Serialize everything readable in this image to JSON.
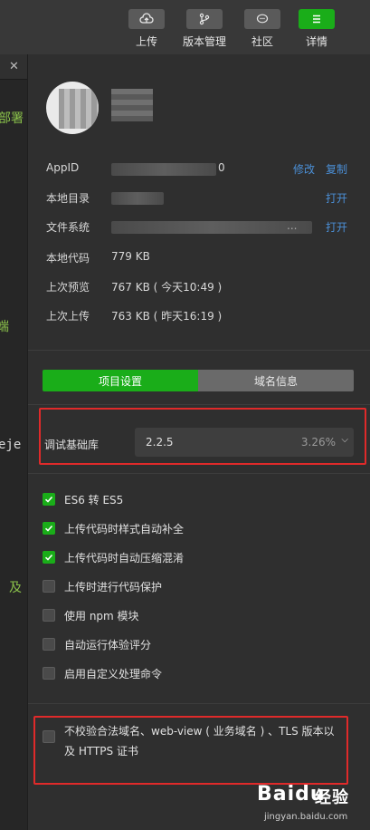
{
  "toolbar": {
    "buttons": [
      {
        "label": "上传",
        "icon": "cloud-upload-icon"
      },
      {
        "label": "版本管理",
        "icon": "branch-icon"
      },
      {
        "label": "社区",
        "icon": "chat-bubble-icon"
      },
      {
        "label": "详情",
        "icon": "menu-icon"
      }
    ],
    "accent": "#1aad19"
  },
  "editor": {
    "close_glyph": "✕",
    "fragments": [
      "部署",
      "端",
      "eje",
      "及"
    ],
    "fragment_color": "#8ac14a"
  },
  "details": {
    "appid_label": "AppID",
    "appid_suffix": "0",
    "edit_link": "修改",
    "copy_link": "复制",
    "local_dir_label": "本地目录",
    "open_link": "打开",
    "file_system_label": "文件系统",
    "file_system_ellipsis": "...",
    "open_link_2": "打开",
    "local_code_label": "本地代码",
    "local_code_value": "779 KB",
    "last_preview_label": "上次预览",
    "last_preview_value": "767 KB ( 今天10:49 )",
    "last_upload_label": "上次上传",
    "last_upload_value": "763 KB ( 昨天16:19 )"
  },
  "tabs": {
    "project_settings": "项目设置",
    "domain_info": "域名信息"
  },
  "debug_lib": {
    "label": "调试基础库",
    "version": "2.2.5",
    "percent": "3.26%"
  },
  "options": [
    {
      "label": "ES6 转 ES5",
      "checked": true
    },
    {
      "label": "上传代码时样式自动补全",
      "checked": true
    },
    {
      "label": "上传代码时自动压缩混淆",
      "checked": true
    },
    {
      "label": "上传时进行代码保护",
      "checked": false
    },
    {
      "label": "使用 npm 模块",
      "checked": false
    },
    {
      "label": "自动运行体验评分",
      "checked": false
    },
    {
      "label": "启用自定义处理命令",
      "checked": false
    }
  ],
  "domain_check": {
    "label": "不校验合法域名、web-view ( 业务域名 ) 、TLS 版本以及 HTTPS 证书",
    "checked": false
  },
  "watermark": {
    "logo": "Baidu",
    "suffix": "经验",
    "url": "jingyan.baidu.com"
  },
  "colors": {
    "link": "#4b8fd6",
    "highlight_box": "#e02a2a"
  }
}
